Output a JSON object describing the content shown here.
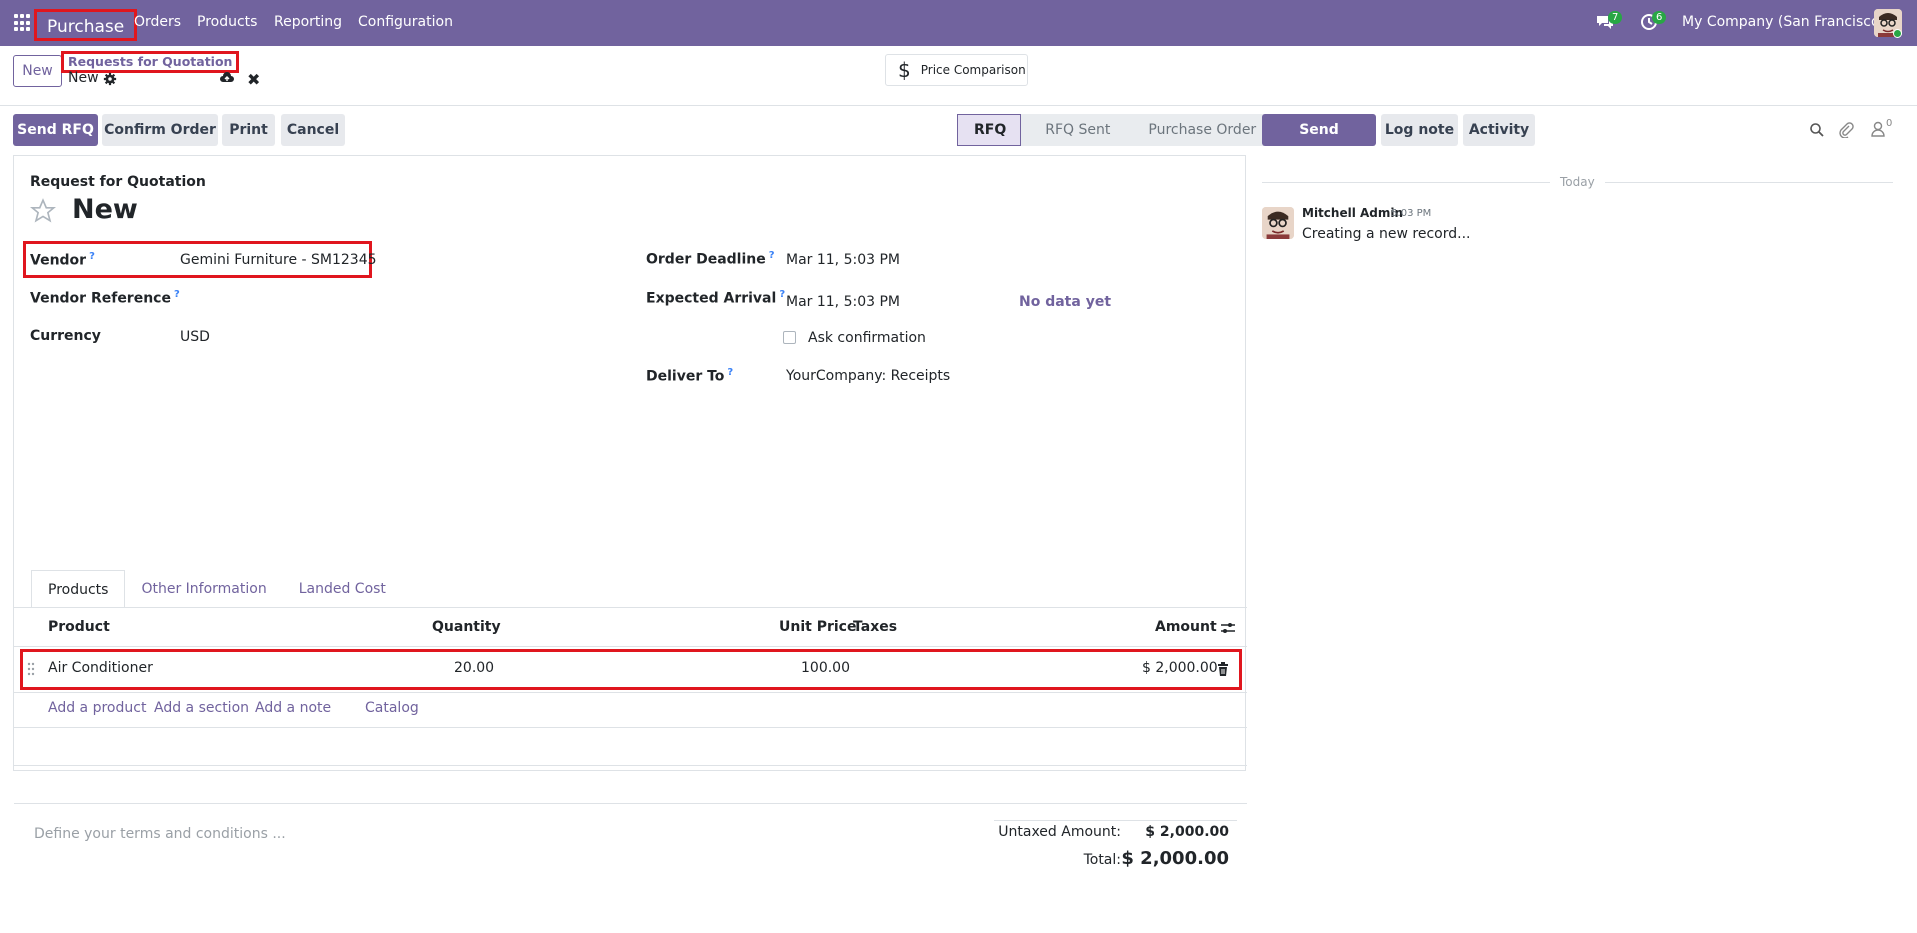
{
  "navbar": {
    "app_name": "Purchase",
    "menu": [
      "Orders",
      "Products",
      "Reporting",
      "Configuration"
    ],
    "messages_count": "7",
    "activities_count": "6",
    "company": "My Company (San Francisco)"
  },
  "control_panel": {
    "new_label": "New",
    "breadcrumb_parent": "Requests for Quotation",
    "breadcrumb_current": "New",
    "price_comparison_label": "Price Comparison"
  },
  "actions": {
    "send_rfq": "Send RFQ",
    "confirm_order": "Confirm Order",
    "print": "Print",
    "cancel": "Cancel"
  },
  "statusbar": [
    "RFQ",
    "RFQ Sent",
    "Purchase Order"
  ],
  "form": {
    "doc_type": "Request for Quotation",
    "name": "New",
    "vendor_label": "Vendor",
    "vendor_value": "Gemini Furniture - SM12345",
    "vendor_ref_label": "Vendor Reference",
    "currency_label": "Currency",
    "currency_value": "USD",
    "order_deadline_label": "Order Deadline",
    "order_deadline_value": "Mar 11, 5:03 PM",
    "expected_arrival_label": "Expected Arrival",
    "expected_arrival_value": "Mar 11, 5:03 PM",
    "no_data": "No data yet",
    "ask_confirmation": "Ask confirmation",
    "deliver_to_label": "Deliver To",
    "deliver_to_value": "YourCompany: Receipts",
    "help_mark": "?"
  },
  "tabs": [
    "Products",
    "Other Information",
    "Landed Cost"
  ],
  "lines": {
    "columns": {
      "product": "Product",
      "quantity": "Quantity",
      "unit_price": "Unit Price",
      "taxes": "Taxes",
      "amount": "Amount"
    },
    "rows": [
      {
        "product": "Air Conditioner",
        "quantity": "20.00",
        "unit_price": "100.00",
        "taxes": "",
        "amount": "$ 2,000.00"
      }
    ],
    "add_product": "Add a product",
    "add_section": "Add a section",
    "add_note": "Add a note",
    "catalog": "Catalog"
  },
  "terms_placeholder": "Define your terms and conditions ...",
  "totals": {
    "untaxed_label": "Untaxed Amount:",
    "untaxed_value": "$ 2,000.00",
    "total_label": "Total:",
    "total_value": "$ 2,000.00"
  },
  "chatter": {
    "send_message": "Send message",
    "log_note": "Log note",
    "activity": "Activity",
    "followers_count": "0",
    "today": "Today",
    "author": "Mitchell Admin",
    "time": "5:03 PM",
    "body": "Creating a new record..."
  },
  "colors": {
    "brand": "#71639e",
    "highlight": "#e0161e",
    "badge": "#28a745"
  }
}
